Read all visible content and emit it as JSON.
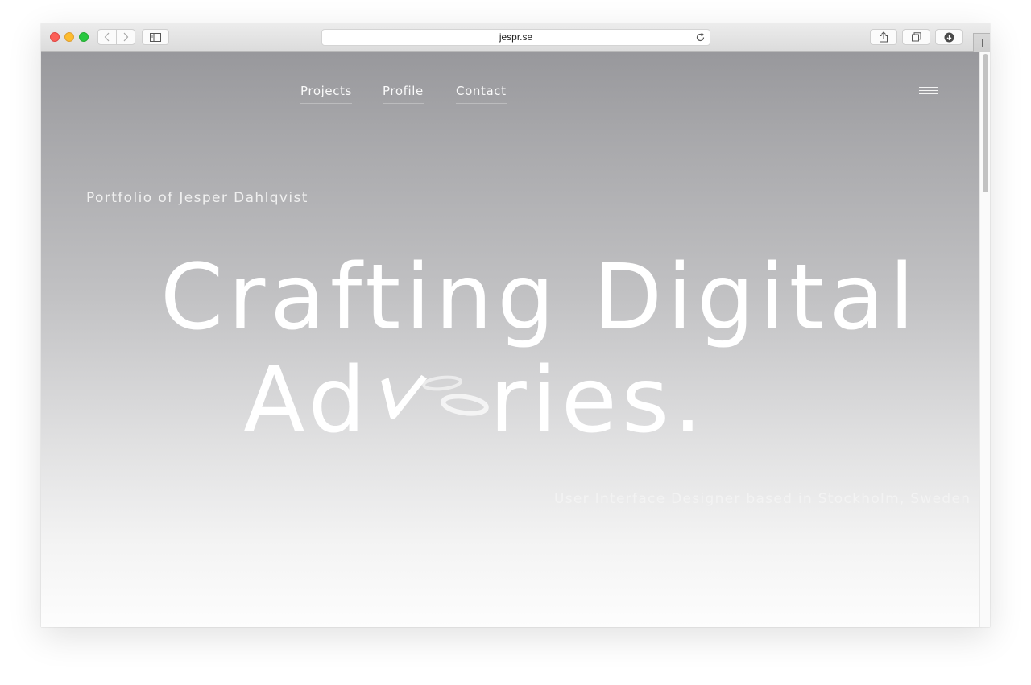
{
  "browser": {
    "url": "jespr.se",
    "icons": {
      "back": "chevron-left-icon",
      "forward": "chevron-right-icon",
      "sidebar": "sidebar-icon",
      "reload": "reload-icon",
      "share": "share-icon",
      "tabs": "tabs-overview-icon",
      "downloads": "download-icon",
      "new_tab": "plus-icon"
    },
    "colors": {
      "close": "#fc5f57",
      "minimize": "#fdbc2e",
      "maximize": "#28c840"
    }
  },
  "nav": {
    "items": [
      {
        "label": "Projects"
      },
      {
        "label": "Profile"
      },
      {
        "label": "Contact"
      }
    ],
    "menu_icon": "hamburger-menu-icon"
  },
  "hero": {
    "eyebrow": "Portfolio of Jesper Dahlqvist",
    "line1": "Crafting Digital",
    "line2_start": "Ad",
    "line2_end": "ries.",
    "tagline": "User Interface Designer based in Stockholm, Sweden"
  },
  "colors": {
    "gradient_top": "#98989c",
    "gradient_bottom": "#fdfdfd",
    "text": "#ffffff"
  }
}
